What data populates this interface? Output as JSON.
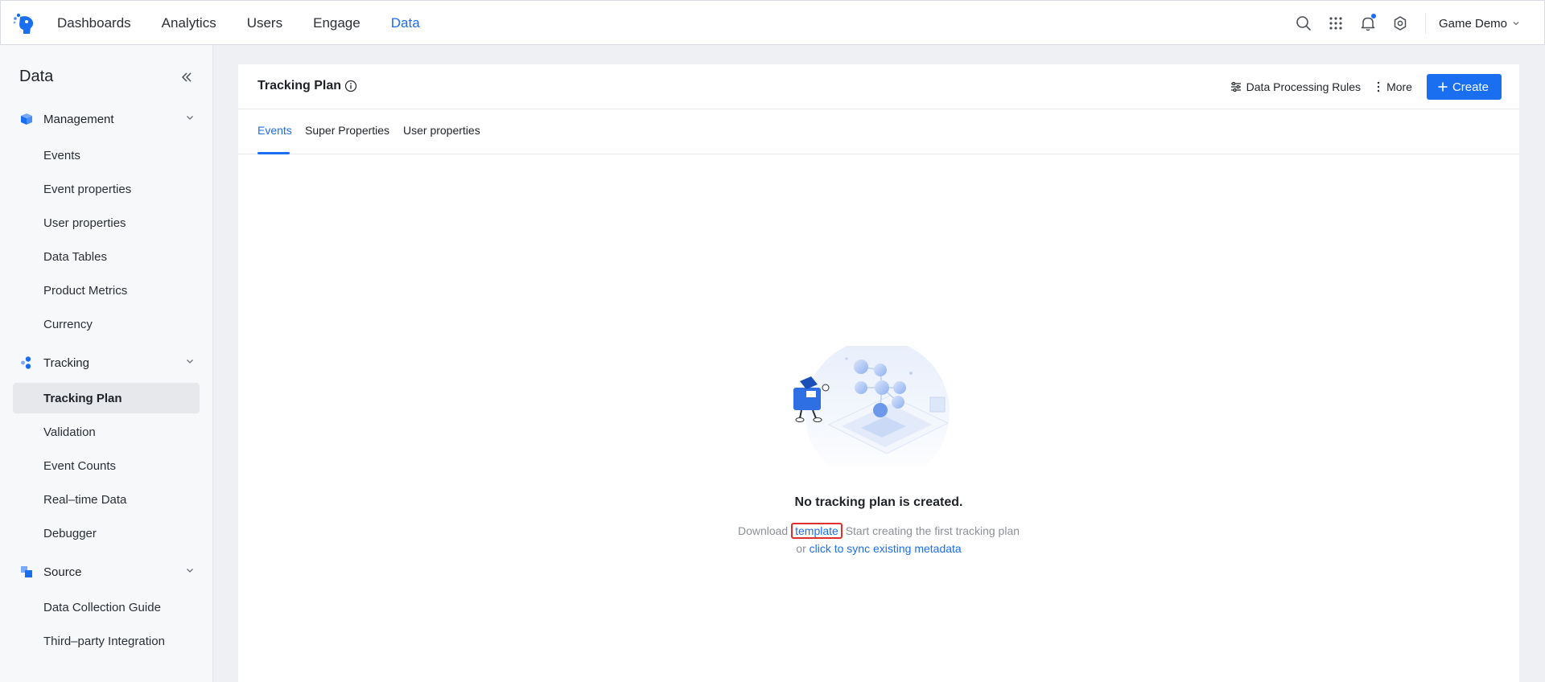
{
  "topnav": {
    "items": [
      {
        "label": "Dashboards",
        "active": false
      },
      {
        "label": "Analytics",
        "active": false
      },
      {
        "label": "Users",
        "active": false
      },
      {
        "label": "Engage",
        "active": false
      },
      {
        "label": "Data",
        "active": true
      }
    ],
    "project": "Game Demo",
    "accent_color": "#1a6ef0"
  },
  "sidebar": {
    "title": "Data",
    "groups": [
      {
        "label": "Management",
        "icon": "cube-icon",
        "items": [
          "Events",
          "Event properties",
          "User properties",
          "Data Tables",
          "Product Metrics",
          "Currency"
        ]
      },
      {
        "label": "Tracking",
        "icon": "dots-icon",
        "items": [
          "Tracking Plan",
          "Validation",
          "Event Counts",
          "Real–time Data",
          "Debugger"
        ],
        "active_item": "Tracking Plan"
      },
      {
        "label": "Source",
        "icon": "squares-icon",
        "items": [
          "Data Collection Guide",
          "Third–party Integration"
        ]
      }
    ]
  },
  "page": {
    "title": "Tracking Plan",
    "actions": {
      "rules_label": "Data Processing Rules",
      "more_label": "More",
      "create_label": "Create"
    },
    "tabs": [
      {
        "label": "Events",
        "active": true
      },
      {
        "label": "Super Properties",
        "active": false
      },
      {
        "label": "User properties",
        "active": false
      }
    ],
    "empty": {
      "title": "No tracking plan is created.",
      "line1_prefix": "Download",
      "line1_link": "template",
      "line1_suffix": "Start creating the first tracking plan",
      "line2_prefix": "or",
      "line2_link": "click to sync existing metadata"
    }
  }
}
